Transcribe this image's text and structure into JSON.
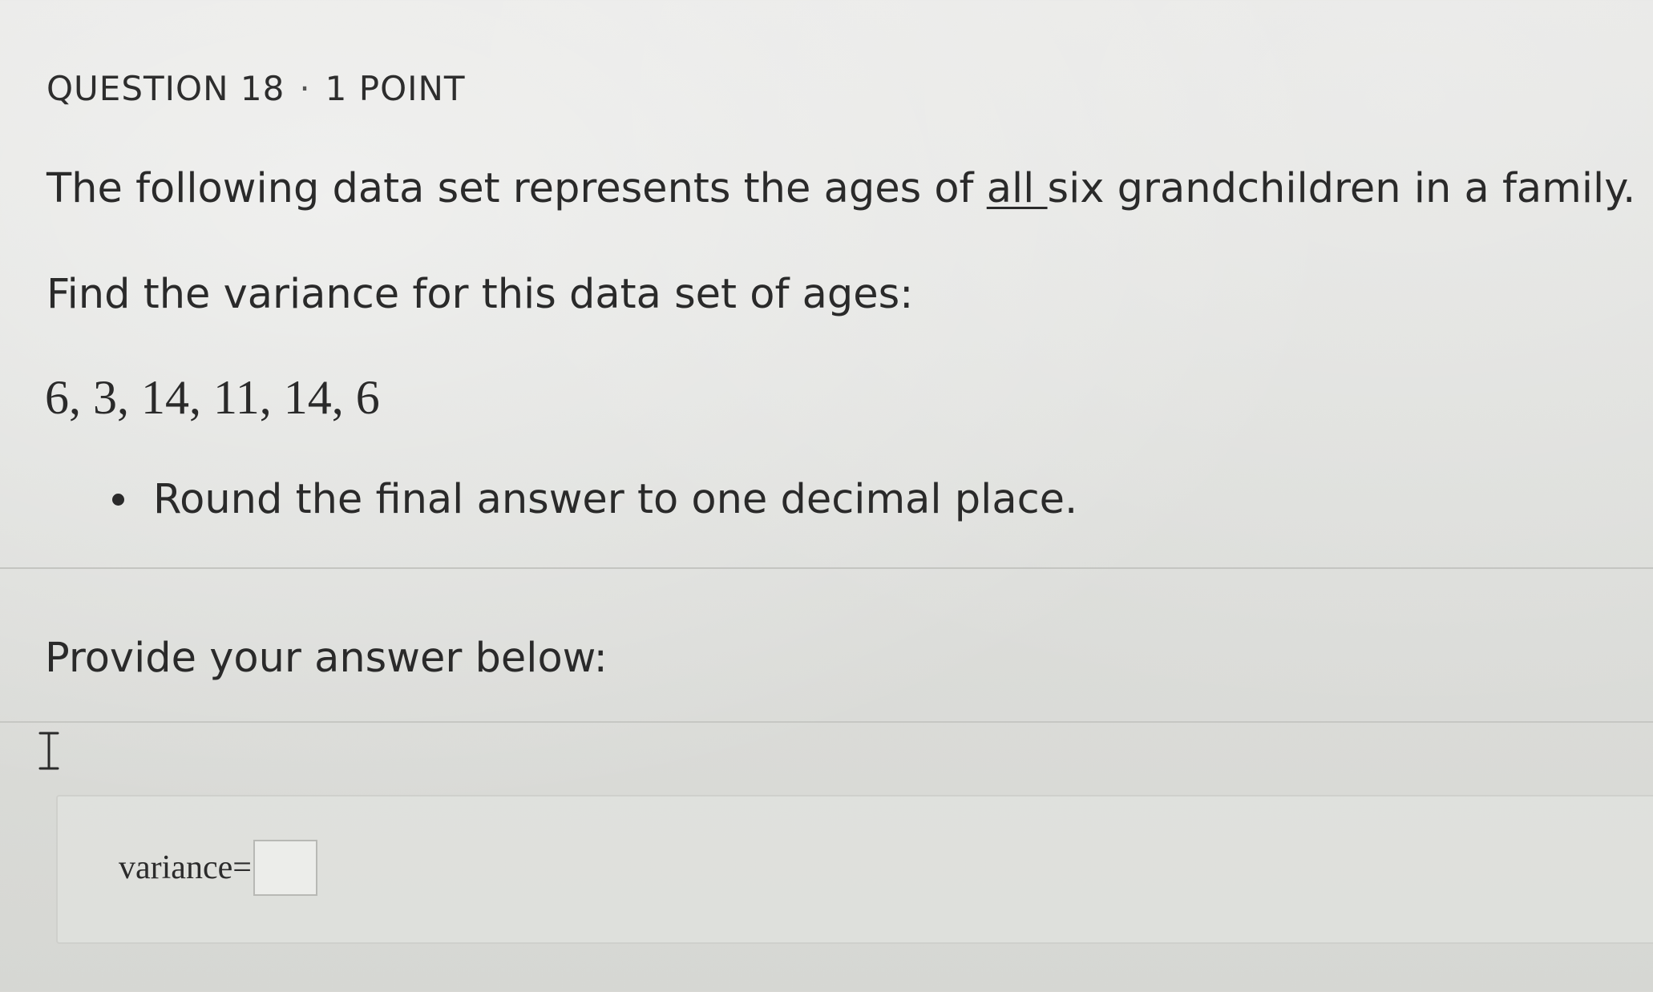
{
  "question": {
    "number_label": "QUESTION 18",
    "separator": "·",
    "points_label": "1 POINT",
    "prompt_line1_before": "The following data set represents the ages of ",
    "prompt_line1_emphasis": "all ",
    "prompt_line1_after": "six grandchildren in a family.",
    "prompt_line2": "Find the variance for this data set of ages:",
    "data_set": "6, 3, 14, 11, 14, 6",
    "instruction": "Round the final answer to one decimal place."
  },
  "answer": {
    "section_label": "Provide your answer below:",
    "field_label": "variance=",
    "field_value": ""
  },
  "colors": {
    "background": "#dedfdc",
    "text": "#2a2a2a",
    "divider": "#c4c5c1"
  },
  "icons": {
    "cursor": "text-cursor-ibeam-icon",
    "bullet": "bullet-dot-icon"
  }
}
